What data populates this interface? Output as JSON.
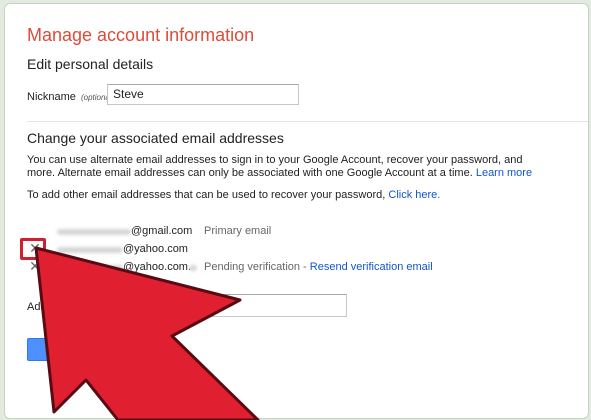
{
  "page": {
    "title": "Manage account information",
    "edit_section_title": "Edit personal details",
    "nickname": {
      "label": "Nickname",
      "optional_note": "(optional)",
      "value": "Steve"
    },
    "email_section": {
      "title": "Change your associated email addresses",
      "description": "You can use alternate email addresses to sign in to your Google Account, recover your password, and more. Alternate email addresses can only be associated with one Google Account at a time.",
      "learn_more": "Learn more",
      "recovery_text": "To add other email addresses that can be used to recover your password,",
      "click_here": "Click here.",
      "emails": [
        {
          "domain": "@gmail.com",
          "status": "Primary email",
          "action": ""
        },
        {
          "domain": "@yahoo.com",
          "status": "",
          "action": ""
        },
        {
          "domain": "@yahoo.com.",
          "status": "Pending verification -",
          "action": "Resend verification email"
        }
      ],
      "remove_glyph": "✕",
      "add_label": "Add a ne",
      "save_label": "Save"
    }
  },
  "colors": {
    "title_red": "#dd4b39",
    "link_blue": "#1155cc",
    "save_blue": "#4d90fe",
    "arrow_red": "#e02030",
    "frame_bg": "#e3ebe0"
  },
  "overlay": {
    "icon": "pointer-arrow-icon",
    "highlight": "remove-email-x-highlight"
  }
}
